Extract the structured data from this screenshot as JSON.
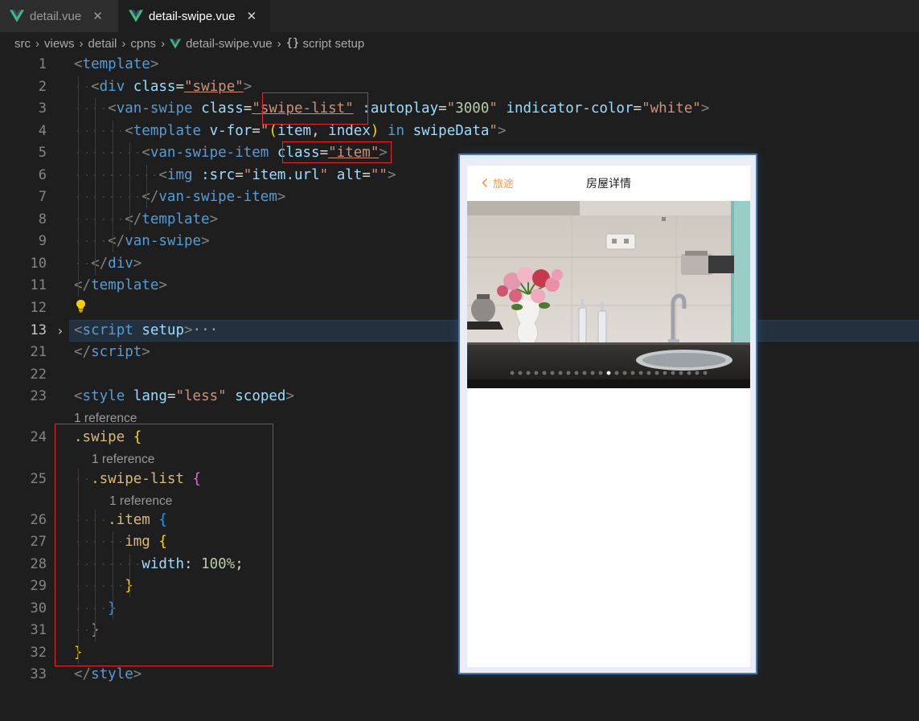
{
  "tabs": [
    {
      "label": "detail.vue",
      "close": "✕",
      "active": false
    },
    {
      "label": "detail-swipe.vue",
      "close": "✕",
      "active": true
    }
  ],
  "breadcrumb": {
    "items": [
      "src",
      "views",
      "detail",
      "cpns",
      "detail-swipe.vue",
      "script setup"
    ],
    "separator": "›",
    "brace": "{}"
  },
  "lines": [
    {
      "n": "1",
      "tokens": [
        [
          "t-punc",
          "<"
        ],
        [
          "t-tag",
          "template"
        ],
        [
          "t-punc",
          ">"
        ]
      ]
    },
    {
      "n": "2",
      "tokens": [
        [
          "t-pl",
          "  "
        ],
        [
          "t-punc",
          "<"
        ],
        [
          "t-tag",
          "div"
        ],
        [
          "t-pl",
          " "
        ],
        [
          "t-attr",
          "class"
        ],
        [
          "t-pl",
          "="
        ],
        [
          "t-str",
          "\"swipe\""
        ],
        [
          "t-punc",
          ">"
        ]
      ]
    },
    {
      "n": "3",
      "tokens": [
        [
          "t-pl",
          "    "
        ],
        [
          "t-punc",
          "<"
        ],
        [
          "t-tag",
          "van-swipe"
        ],
        [
          "t-pl",
          " "
        ],
        [
          "t-attr",
          "class"
        ],
        [
          "t-pl",
          "="
        ],
        [
          "t-str",
          "\"swipe-list\""
        ],
        [
          "t-pl",
          " "
        ],
        [
          "t-attr",
          ":autoplay"
        ],
        [
          "t-pl",
          "="
        ],
        [
          "t-str",
          "\""
        ],
        [
          "t-num",
          "3000"
        ],
        [
          "t-str",
          "\""
        ],
        [
          "t-pl",
          " "
        ],
        [
          "t-attr",
          "indicator-color"
        ],
        [
          "t-pl",
          "="
        ],
        [
          "t-str",
          "\"white\""
        ],
        [
          "t-punc",
          ">"
        ]
      ]
    },
    {
      "n": "4",
      "tokens": [
        [
          "t-pl",
          "      "
        ],
        [
          "t-punc",
          "<"
        ],
        [
          "t-tag",
          "template"
        ],
        [
          "t-pl",
          " "
        ],
        [
          "t-attr",
          "v-for"
        ],
        [
          "t-pl",
          "="
        ],
        [
          "t-str",
          "\""
        ],
        [
          "t-br1",
          "("
        ],
        [
          "t-attr",
          "item"
        ],
        [
          "t-pl",
          ", "
        ],
        [
          "t-attr",
          "index"
        ],
        [
          "t-br1",
          ")"
        ],
        [
          "t-pl",
          " "
        ],
        [
          "t-kw",
          "in"
        ],
        [
          "t-pl",
          " "
        ],
        [
          "t-attr",
          "swipeData"
        ],
        [
          "t-str",
          "\""
        ],
        [
          "t-punc",
          ">"
        ]
      ]
    },
    {
      "n": "5",
      "tokens": [
        [
          "t-pl",
          "        "
        ],
        [
          "t-punc",
          "<"
        ],
        [
          "t-tag",
          "van-swipe-item"
        ],
        [
          "t-pl",
          " "
        ],
        [
          "t-attr",
          "class"
        ],
        [
          "t-pl",
          "="
        ],
        [
          "t-str",
          "\"item\""
        ],
        [
          "t-punc",
          ">"
        ]
      ]
    },
    {
      "n": "6",
      "tokens": [
        [
          "t-pl",
          "          "
        ],
        [
          "t-punc",
          "<"
        ],
        [
          "t-tag",
          "img"
        ],
        [
          "t-pl",
          " "
        ],
        [
          "t-attr",
          ":src"
        ],
        [
          "t-pl",
          "="
        ],
        [
          "t-str",
          "\""
        ],
        [
          "t-attr",
          "item.url"
        ],
        [
          "t-str",
          "\""
        ],
        [
          "t-pl",
          " "
        ],
        [
          "t-attr",
          "alt"
        ],
        [
          "t-pl",
          "="
        ],
        [
          "t-str",
          "\"\""
        ],
        [
          "t-punc",
          ">"
        ]
      ]
    },
    {
      "n": "7",
      "tokens": [
        [
          "t-pl",
          "        "
        ],
        [
          "t-punc",
          "</"
        ],
        [
          "t-tag",
          "van-swipe-item"
        ],
        [
          "t-punc",
          ">"
        ]
      ]
    },
    {
      "n": "8",
      "tokens": [
        [
          "t-pl",
          "      "
        ],
        [
          "t-punc",
          "</"
        ],
        [
          "t-tag",
          "template"
        ],
        [
          "t-punc",
          ">"
        ]
      ]
    },
    {
      "n": "9",
      "tokens": [
        [
          "t-pl",
          "    "
        ],
        [
          "t-punc",
          "</"
        ],
        [
          "t-tag",
          "van-swipe"
        ],
        [
          "t-punc",
          ">"
        ]
      ]
    },
    {
      "n": "10",
      "tokens": [
        [
          "t-pl",
          "  "
        ],
        [
          "t-punc",
          "</"
        ],
        [
          "t-tag",
          "div"
        ],
        [
          "t-punc",
          ">"
        ]
      ]
    },
    {
      "n": "11",
      "tokens": [
        [
          "t-punc",
          "</"
        ],
        [
          "t-tag",
          "template"
        ],
        [
          "t-punc",
          ">"
        ]
      ]
    },
    {
      "n": "12",
      "tokens": []
    },
    {
      "n": "13",
      "tokens": [
        [
          "t-punc",
          "<"
        ],
        [
          "t-tag",
          "script"
        ],
        [
          "t-pl",
          " "
        ],
        [
          "t-attr",
          "setup"
        ],
        [
          "t-punc",
          ">"
        ],
        [
          "t-ell",
          "···"
        ]
      ]
    },
    {
      "n": "21",
      "tokens": [
        [
          "t-punc",
          "</"
        ],
        [
          "t-tag",
          "script"
        ],
        [
          "t-punc",
          ">"
        ]
      ]
    },
    {
      "n": "22",
      "tokens": []
    },
    {
      "n": "23",
      "tokens": [
        [
          "t-punc",
          "<"
        ],
        [
          "t-tag",
          "style"
        ],
        [
          "t-pl",
          " "
        ],
        [
          "t-attr",
          "lang"
        ],
        [
          "t-pl",
          "="
        ],
        [
          "t-str",
          "\"less\""
        ],
        [
          "t-pl",
          " "
        ],
        [
          "t-attr",
          "scoped"
        ],
        [
          "t-punc",
          ">"
        ]
      ]
    },
    {
      "n": "24",
      "tokens": [
        [
          "t-sel",
          ".swipe"
        ],
        [
          "t-pl",
          " "
        ],
        [
          "t-br1",
          "{"
        ]
      ]
    },
    {
      "n": "25",
      "tokens": [
        [
          "t-pl",
          "  "
        ],
        [
          "t-sel",
          ".swipe-list"
        ],
        [
          "t-pl",
          " "
        ],
        [
          "t-br2",
          "{"
        ]
      ]
    },
    {
      "n": "26",
      "tokens": [
        [
          "t-pl",
          "    "
        ],
        [
          "t-sel",
          ".item"
        ],
        [
          "t-pl",
          " "
        ],
        [
          "t-br3",
          "{"
        ]
      ]
    },
    {
      "n": "27",
      "tokens": [
        [
          "t-pl",
          "      "
        ],
        [
          "t-sel",
          "img"
        ],
        [
          "t-pl",
          " "
        ],
        [
          "t-br1",
          "{"
        ]
      ]
    },
    {
      "n": "28",
      "tokens": [
        [
          "t-pl",
          "        "
        ],
        [
          "t-prop",
          "width"
        ],
        [
          "t-pl",
          ": "
        ],
        [
          "t-num",
          "100%"
        ],
        [
          "t-pl",
          ";"
        ]
      ]
    },
    {
      "n": "29",
      "tokens": [
        [
          "t-pl",
          "      "
        ],
        [
          "t-br1",
          "}"
        ]
      ]
    },
    {
      "n": "30",
      "tokens": [
        [
          "t-pl",
          "    "
        ],
        [
          "t-br3",
          "}"
        ]
      ]
    },
    {
      "n": "31",
      "tokens": [
        [
          "t-pl",
          "  "
        ],
        [
          "t-br2",
          "}"
        ]
      ]
    },
    {
      "n": "32",
      "tokens": [
        [
          "t-br1",
          "}"
        ]
      ]
    },
    {
      "n": "33",
      "tokens": [
        [
          "t-punc",
          "</"
        ],
        [
          "t-tag",
          "style"
        ],
        [
          "t-punc",
          ">"
        ]
      ]
    }
  ],
  "codelens": {
    "ref24": "1 reference",
    "ref25": "1 reference",
    "ref26": "1 reference"
  },
  "phone": {
    "back_label": "旅途",
    "back_icon": "chevron-left",
    "title": "房屋详情",
    "indicator_count": 25,
    "indicator_active": 12,
    "accent": "#ff9645"
  }
}
